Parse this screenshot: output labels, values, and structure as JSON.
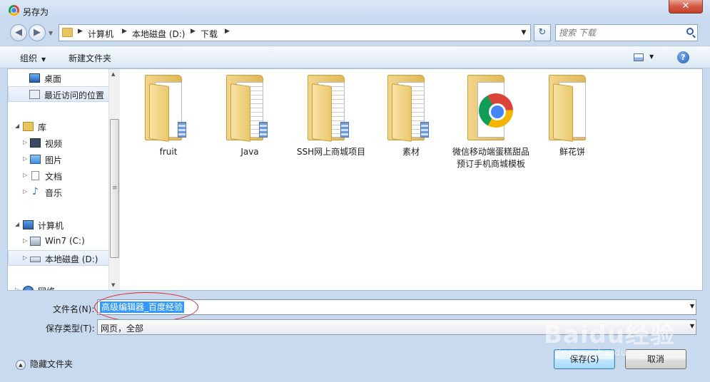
{
  "window": {
    "title": "另存为",
    "close_label": "✕"
  },
  "address_bar": {
    "crumbs": [
      "计算机",
      "本地磁盘 (D:)",
      "下载"
    ],
    "search_placeholder": "搜索 下载"
  },
  "toolbar": {
    "organize_label": "组织",
    "new_folder_label": "新建文件夹",
    "help_label": "?"
  },
  "nav_pane": {
    "items": [
      {
        "label": "桌面",
        "icon": "desktop-icon"
      },
      {
        "label": "最近访问的位置",
        "icon": "recent-places-icon"
      },
      {
        "label": "库",
        "icon": "library-icon"
      },
      {
        "label": "视频",
        "icon": "video-icon"
      },
      {
        "label": "图片",
        "icon": "pictures-icon"
      },
      {
        "label": "文档",
        "icon": "documents-icon"
      },
      {
        "label": "音乐",
        "icon": "music-icon"
      },
      {
        "label": "计算机",
        "icon": "computer-icon"
      },
      {
        "label": "Win7 (C:)",
        "icon": "drive-c-icon"
      },
      {
        "label": "本地磁盘 (D:)",
        "icon": "drive-d-icon"
      },
      {
        "label": "网络",
        "icon": "network-icon"
      }
    ]
  },
  "files": [
    {
      "name": "fruit",
      "icon": "folder-icon"
    },
    {
      "name": "Java",
      "icon": "folder-icon"
    },
    {
      "name": "SSH网上商城项目",
      "icon": "folder-icon"
    },
    {
      "name": "素材",
      "icon": "folder-icon"
    },
    {
      "name": "微信移动端蛋糕甜品预订手机商城模板",
      "icon": "folder-chrome-icon"
    },
    {
      "name": "鲜花饼",
      "icon": "folder-icon"
    }
  ],
  "form": {
    "filename_label": "文件名(N):",
    "filename_value": "高级编辑器_百度经验",
    "filetype_label": "保存类型(T):",
    "filetype_value": "网页，全部"
  },
  "footer": {
    "hide_folders_label": "隐藏文件夹",
    "save_label": "保存(S)",
    "cancel_label": "取消"
  },
  "watermark": {
    "main": "Baidu经验",
    "sub": "jingyan.baidu.com"
  }
}
